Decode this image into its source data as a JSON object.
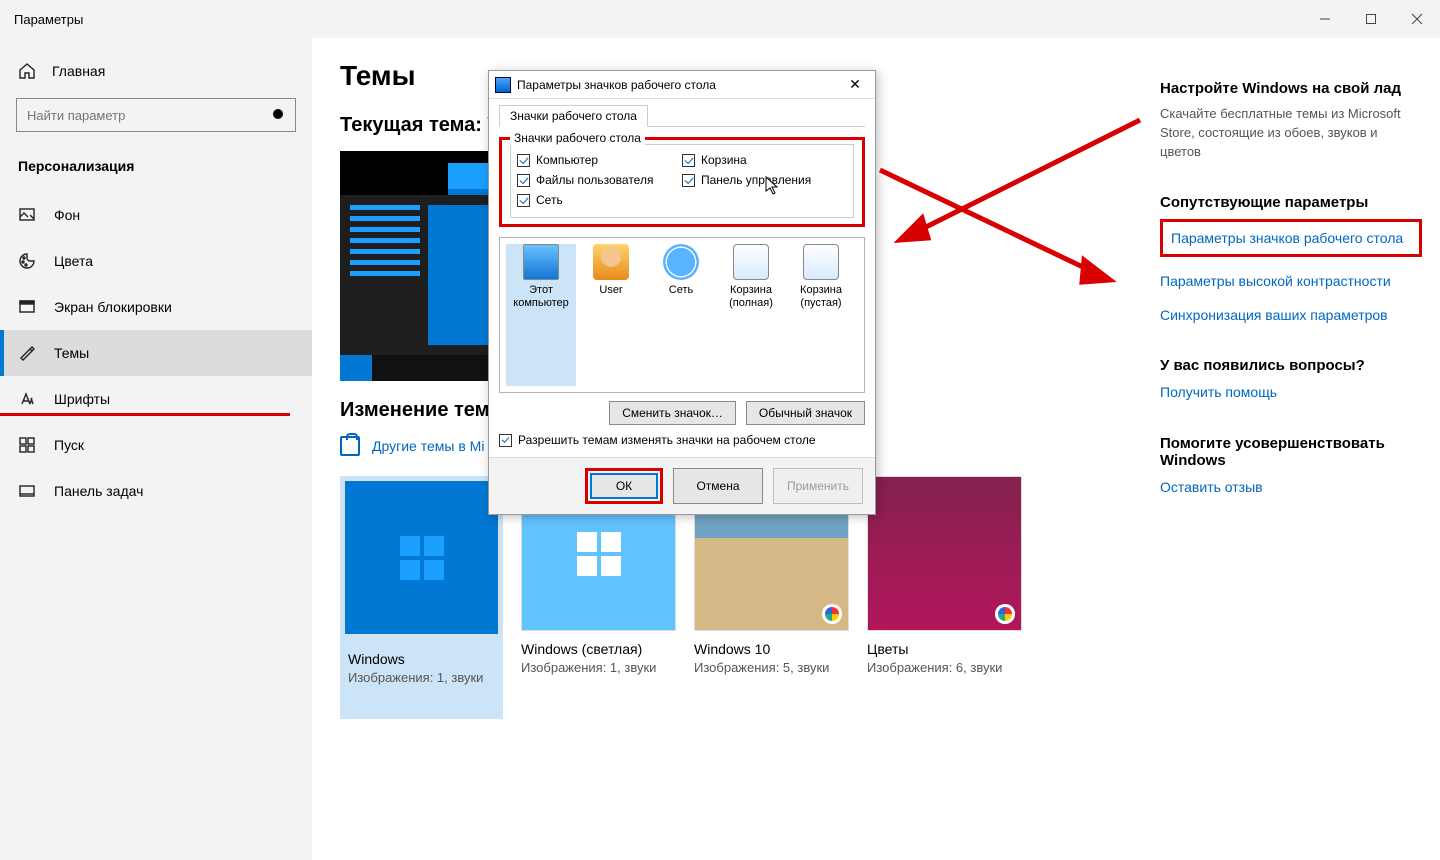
{
  "window": {
    "title": "Параметры"
  },
  "sidebar": {
    "home": "Главная",
    "search_placeholder": "Найти параметр",
    "section": "Персонализация",
    "items": [
      {
        "label": "Фон"
      },
      {
        "label": "Цвета"
      },
      {
        "label": "Экран блокировки"
      },
      {
        "label": "Темы"
      },
      {
        "label": "Шрифты"
      },
      {
        "label": "Пуск"
      },
      {
        "label": "Панель задач"
      }
    ]
  },
  "main": {
    "title": "Темы",
    "current_theme_label": "Текущая тема: W",
    "change_theme_label": "Изменение темы",
    "more_themes_link": "Другие темы в Mi",
    "themes": [
      {
        "name": "Windows",
        "meta": "Изображения: 1, звуки"
      },
      {
        "name": "Windows (светлая)",
        "meta": "Изображения: 1, звуки"
      },
      {
        "name": "Windows 10",
        "meta": "Изображения: 5, звуки"
      },
      {
        "name": "Цветы",
        "meta": "Изображения: 6, звуки"
      }
    ]
  },
  "rightcol": {
    "personalize_heading": "Настройте Windows на свой лад",
    "personalize_text": "Скачайте бесплатные темы из Microsoft Store, состоящие из обоев, звуков и цветов",
    "related_heading": "Сопутствующие параметры",
    "link_desktop_icons": "Параметры значков рабочего стола",
    "link_high_contrast": "Параметры высокой контрастности",
    "link_sync": "Синхронизация ваших параметров",
    "questions_heading": "У вас появились вопросы?",
    "link_help": "Получить помощь",
    "improve_heading": "Помогите усовершенствовать Windows",
    "link_feedback": "Оставить отзыв"
  },
  "dialog": {
    "title": "Параметры значков рабочего стола",
    "tab": "Значки рабочего стола",
    "group_label": "Значки рабочего стола",
    "checkboxes": {
      "computer": "Компьютер",
      "user_files": "Файлы пользователя",
      "network": "Сеть",
      "recycle": "Корзина",
      "control_panel": "Панель управления"
    },
    "icons": {
      "computer": "Этот компьютер",
      "user": "User",
      "network": "Сеть",
      "recycle_full": "Корзина (полная)",
      "recycle_empty": "Корзина (пустая)"
    },
    "change_icon_btn": "Сменить значок…",
    "default_icon_btn": "Обычный значок",
    "allow_themes": "Разрешить темам изменять значки на рабочем столе",
    "ok": "ОК",
    "cancel": "Отмена",
    "apply": "Применить"
  }
}
